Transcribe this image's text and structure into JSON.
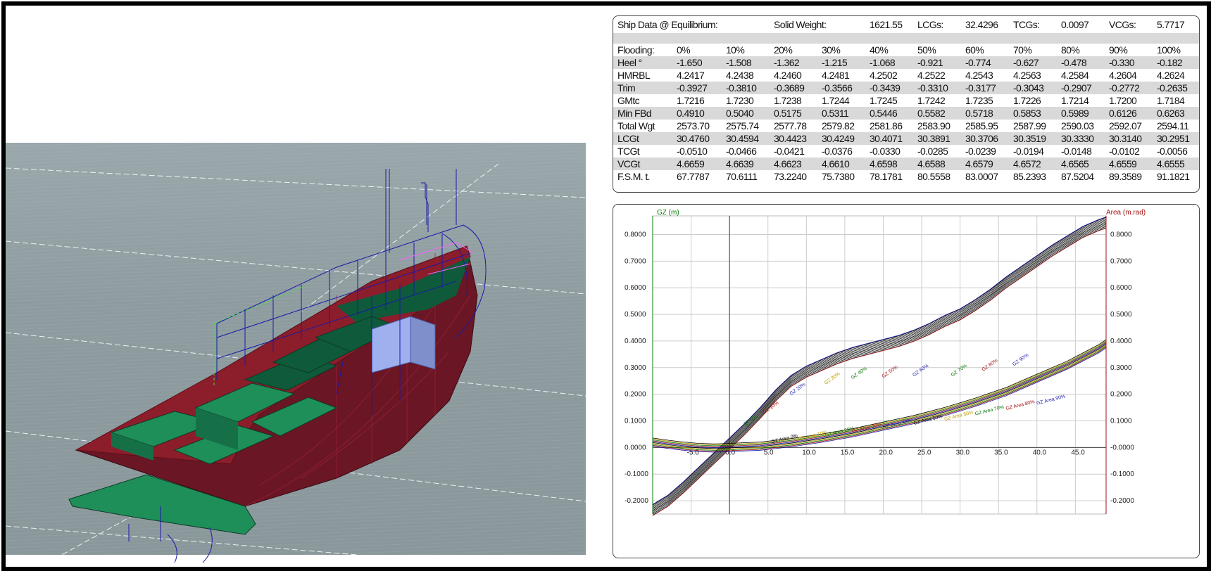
{
  "equilibrium": {
    "label": "Ship Data @ Equilibrium:",
    "solid_weight_label": "Solid Weight:",
    "solid_weight": "1621.55",
    "lcgs_label": "LCGs:",
    "lcgs": "32.4296",
    "tcgs_label": "TCGs:",
    "tcgs": "0.0097",
    "vcgs_label": "VCGs:",
    "vcgs": "5.7717"
  },
  "table": {
    "flooding_label": "Flooding:",
    "flooding": [
      "0%",
      "10%",
      "20%",
      "30%",
      "40%",
      "50%",
      "60%",
      "70%",
      "80%",
      "90%",
      "100%"
    ],
    "rows": [
      {
        "label": "Heel °",
        "values": [
          "-1.650",
          "-1.508",
          "-1.362",
          "-1.215",
          "-1.068",
          "-0.921",
          "-0.774",
          "-0.627",
          "-0.478",
          "-0.330",
          "-0.182"
        ]
      },
      {
        "label": "HMRBL",
        "values": [
          "4.2417",
          "4.2438",
          "4.2460",
          "4.2481",
          "4.2502",
          "4.2522",
          "4.2543",
          "4.2563",
          "4.2584",
          "4.2604",
          "4.2624"
        ]
      },
      {
        "label": "Trim",
        "values": [
          "-0.3927",
          "-0.3810",
          "-0.3689",
          "-0.3566",
          "-0.3439",
          "-0.3310",
          "-0.3177",
          "-0.3043",
          "-0.2907",
          "-0.2772",
          "-0.2635"
        ]
      },
      {
        "label": "GMtc",
        "values": [
          "1.7216",
          "1.7230",
          "1.7238",
          "1.7244",
          "1.7245",
          "1.7242",
          "1.7235",
          "1.7226",
          "1.7214",
          "1.7200",
          "1.7184"
        ]
      },
      {
        "label": "Min FBd",
        "values": [
          "0.4910",
          "0.5040",
          "0.5175",
          "0.5311",
          "0.5446",
          "0.5582",
          "0.5718",
          "0.5853",
          "0.5989",
          "0.6126",
          "0.6263"
        ]
      },
      {
        "label": "Total Wgt",
        "values": [
          "2573.70",
          "2575.74",
          "2577.78",
          "2579.82",
          "2581.86",
          "2583.90",
          "2585.95",
          "2587.99",
          "2590.03",
          "2592.07",
          "2594.11"
        ]
      },
      {
        "label": "LCGt",
        "values": [
          "30.4760",
          "30.4594",
          "30.4423",
          "30.4249",
          "30.4071",
          "30.3891",
          "30.3706",
          "30.3519",
          "30.3330",
          "30.3140",
          "30.2951"
        ]
      },
      {
        "label": "TCGt",
        "values": [
          "-0.0510",
          "-0.0466",
          "-0.0421",
          "-0.0376",
          "-0.0330",
          "-0.0285",
          "-0.0239",
          "-0.0194",
          "-0.0148",
          "-0.0102",
          "-0.0056"
        ]
      },
      {
        "label": "VCGt",
        "values": [
          "4.6659",
          "4.6639",
          "4.6623",
          "4.6610",
          "4.6598",
          "4.6588",
          "4.6579",
          "4.6572",
          "4.6565",
          "4.6559",
          "4.6555"
        ]
      },
      {
        "label": "F.S.M. t.",
        "values": [
          "67.7787",
          "70.6111",
          "73.2240",
          "75.7380",
          "78.1781",
          "80.5558",
          "83.0007",
          "85.2393",
          "87.5204",
          "89.3589",
          "91.1821"
        ]
      }
    ]
  },
  "chart_data": {
    "type": "line",
    "y_left_label": "GZ (m)",
    "y_right_label": "Area (m.rad)",
    "x_ticks": [
      "-5.0",
      "0.0",
      "5.0",
      "10.0",
      "15.0",
      "20.0",
      "25.0",
      "30.0",
      "35.0",
      "40.0",
      "45.0"
    ],
    "y_ticks": [
      "0.8000",
      "0.7000",
      "0.6000",
      "0.5000",
      "0.4000",
      "0.3000",
      "0.2000",
      "0.1000",
      "0.0000",
      "-0.1000",
      "-0.2000"
    ],
    "right_ticks": [
      "0.8000",
      "0.7000",
      "0.6000",
      "0.5000",
      "0.4000",
      "0.3000",
      "0.2000",
      "0.1000",
      "-0.0000",
      "-0.1000",
      "-0.2000"
    ],
    "xlim": [
      -10,
      49
    ],
    "ylim": [
      -0.25,
      0.87
    ],
    "gz_curve": {
      "x": [
        -10,
        -8,
        -6,
        -4,
        -2,
        0,
        2,
        4,
        6,
        8,
        10,
        12,
        14,
        16,
        18,
        20,
        22,
        24,
        26,
        28,
        30,
        32,
        34,
        36,
        38,
        40,
        42,
        44,
        46,
        48,
        49
      ],
      "y": [
        -0.235,
        -0.2,
        -0.15,
        -0.095,
        -0.04,
        0.015,
        0.07,
        0.13,
        0.195,
        0.25,
        0.285,
        0.31,
        0.335,
        0.355,
        0.37,
        0.385,
        0.4,
        0.42,
        0.445,
        0.475,
        0.5,
        0.535,
        0.575,
        0.62,
        0.66,
        0.7,
        0.74,
        0.775,
        0.81,
        0.835,
        0.845
      ]
    },
    "area_curve": {
      "x": [
        -10,
        -8,
        -6,
        -4,
        -2,
        0,
        4,
        8,
        12,
        16,
        20,
        24,
        28,
        32,
        36,
        40,
        44,
        48,
        49
      ],
      "y": [
        0.02,
        0.012,
        0.005,
        0.0,
        -0.002,
        0.0,
        0.005,
        0.018,
        0.035,
        0.055,
        0.08,
        0.105,
        0.135,
        0.17,
        0.21,
        0.26,
        0.31,
        0.37,
        0.39
      ]
    },
    "series_labels": {
      "gz": [
        "GZ 0%",
        "GZ 10%",
        "GZ 20%",
        "GZ 30%",
        "GZ 40%",
        "GZ 50%",
        "GZ 60%",
        "GZ 70%",
        "GZ 80%",
        "GZ 90%"
      ],
      "area": [
        "GZ Area 0%",
        "GZ Area 10%",
        "GZ Area 20%",
        "GZ Area 30%",
        "GZ Area 40%",
        "GZ Area 50%",
        "GZ Area 60%",
        "GZ Area 70%",
        "GZ Area 80%",
        "GZ Area 90%"
      ]
    },
    "grid": true
  },
  "colors": {
    "hull": "#6a1624",
    "deck_red": "#8c1d2a",
    "hatch_green": "#1f8f5a",
    "hatch_dark": "#0e5a3a",
    "wireframe": "#1a1aa8",
    "water": "#8e9ca0",
    "row_shade": "#d9d9d9",
    "gz_left_axis": "#0a7a0a",
    "area_right_axis": "#a01010"
  }
}
